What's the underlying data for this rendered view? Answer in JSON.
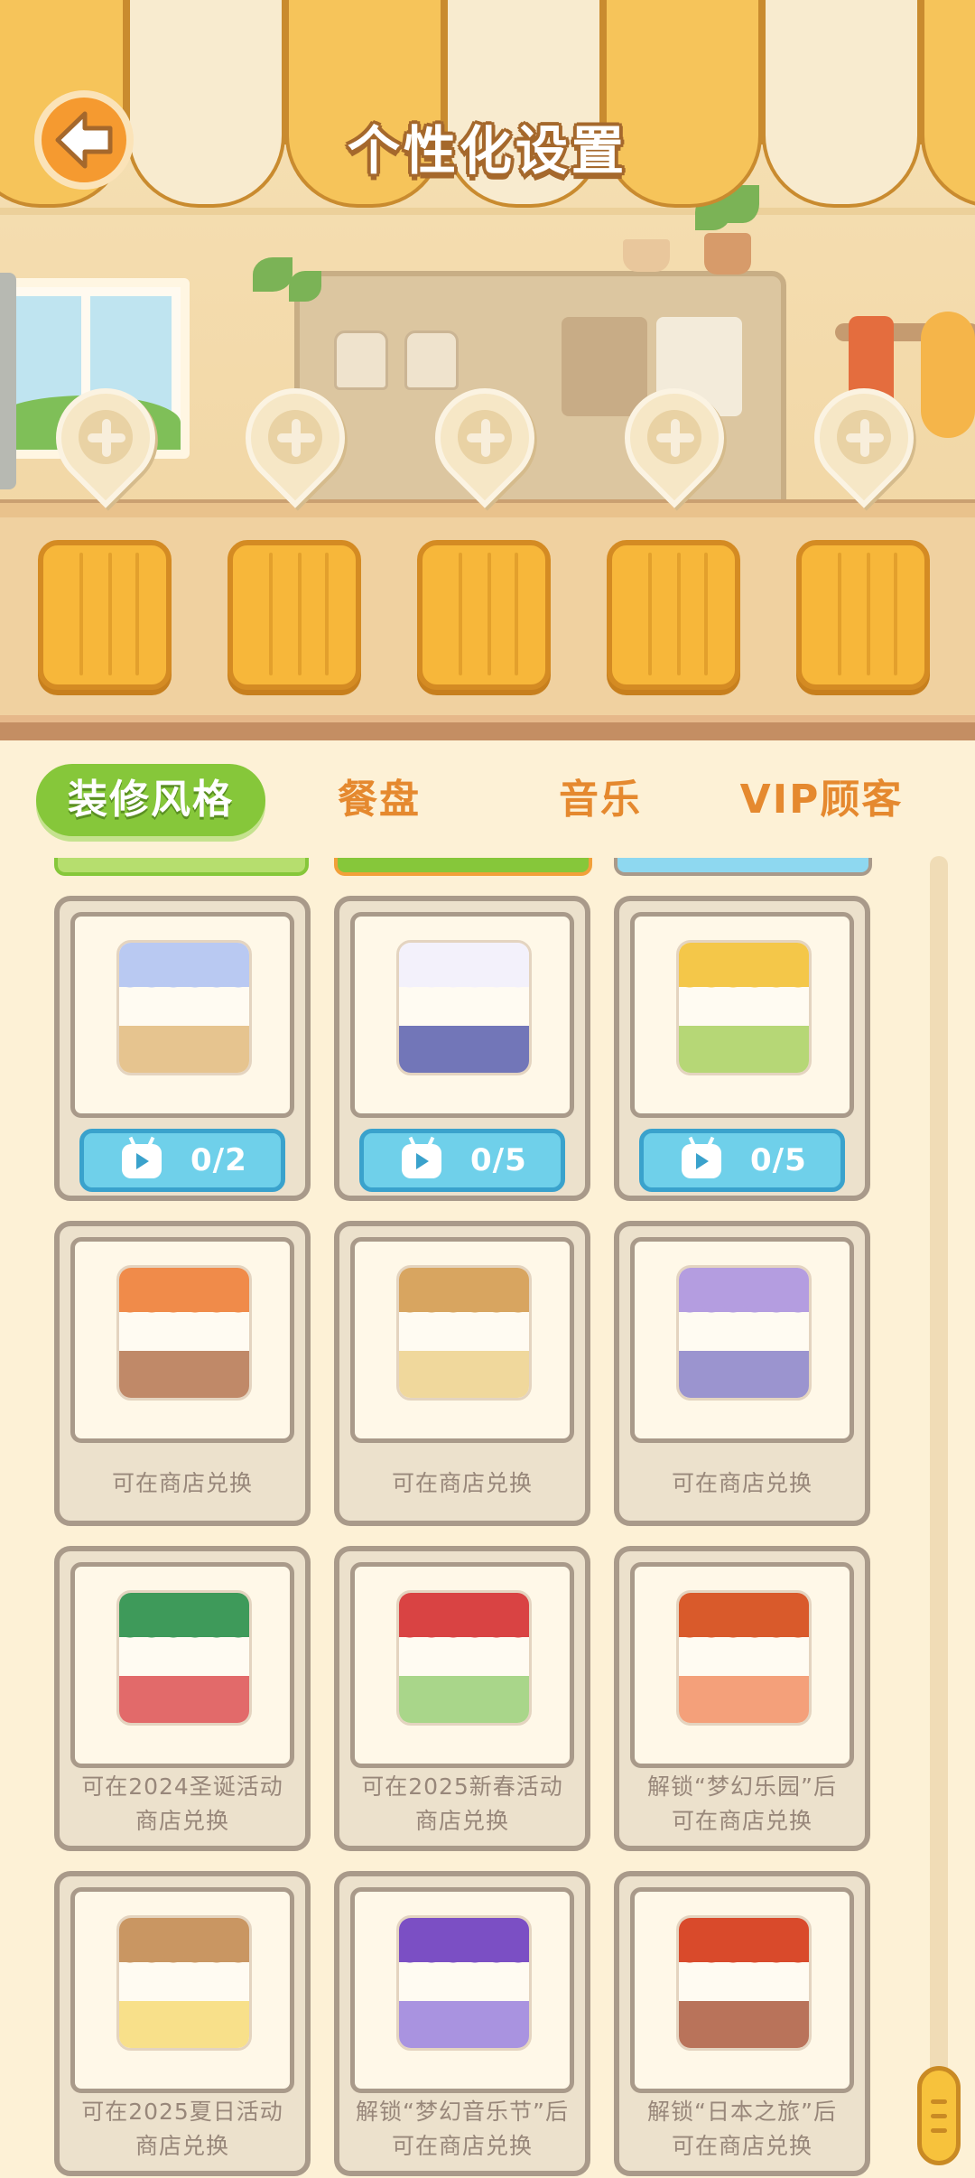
{
  "header": {
    "title": "个性化设置",
    "back_icon": "arrow-left-icon"
  },
  "scene": {
    "add_slots": [
      {
        "icon": "plus-icon"
      },
      {
        "icon": "plus-icon"
      },
      {
        "icon": "plus-icon"
      },
      {
        "icon": "plus-icon"
      },
      {
        "icon": "plus-icon"
      }
    ],
    "seats": 5
  },
  "tabs": [
    {
      "label": "装修风格",
      "active": true
    },
    {
      "label": "餐盘",
      "active": false
    },
    {
      "label": "音乐",
      "active": false
    },
    {
      "label": "VIP顾客",
      "active": false
    }
  ],
  "styles": [
    {
      "ad_count": "0/2",
      "top": "#b9c9f2",
      "bottom": "#e6c48f"
    },
    {
      "ad_count": "0/5",
      "top": "#f3f1fb",
      "bottom": "#7276b8"
    },
    {
      "ad_count": "0/5",
      "top": "#f4c749",
      "bottom": "#b6d776"
    },
    {
      "unlock": "可在商店兑换",
      "top": "#f08b4a",
      "bottom": "#c08968"
    },
    {
      "unlock": "可在商店兑换",
      "top": "#d8a560",
      "bottom": "#f0d89c"
    },
    {
      "unlock": "可在商店兑换",
      "top": "#b49de0",
      "bottom": "#9b94cf"
    },
    {
      "unlock": "可在2024圣诞活动\n商店兑换",
      "top": "#3e9a5a",
      "bottom": "#e26a6a"
    },
    {
      "unlock": "可在2025新春活动\n商店兑换",
      "top": "#d94343",
      "bottom": "#a9d68a"
    },
    {
      "unlock": "解锁“梦幻乐园”后\n可在商店兑换",
      "top": "#d95a2b",
      "bottom": "#f4a07a"
    },
    {
      "unlock": "可在2025夏日活动\n商店兑换",
      "top": "#c99662",
      "bottom": "#f8e08a"
    },
    {
      "unlock": "解锁“梦幻音乐节”后\n可在商店兑换",
      "top": "#7b4fc4",
      "bottom": "#a993e0"
    },
    {
      "unlock": "解锁“日本之旅”后\n可在商店兑换",
      "top": "#d94a2b",
      "bottom": "#b9735a"
    }
  ],
  "colors": {
    "accent_green": "#86c73a",
    "accent_orange": "#e5892f",
    "ad_blue": "#6fd0ea"
  }
}
